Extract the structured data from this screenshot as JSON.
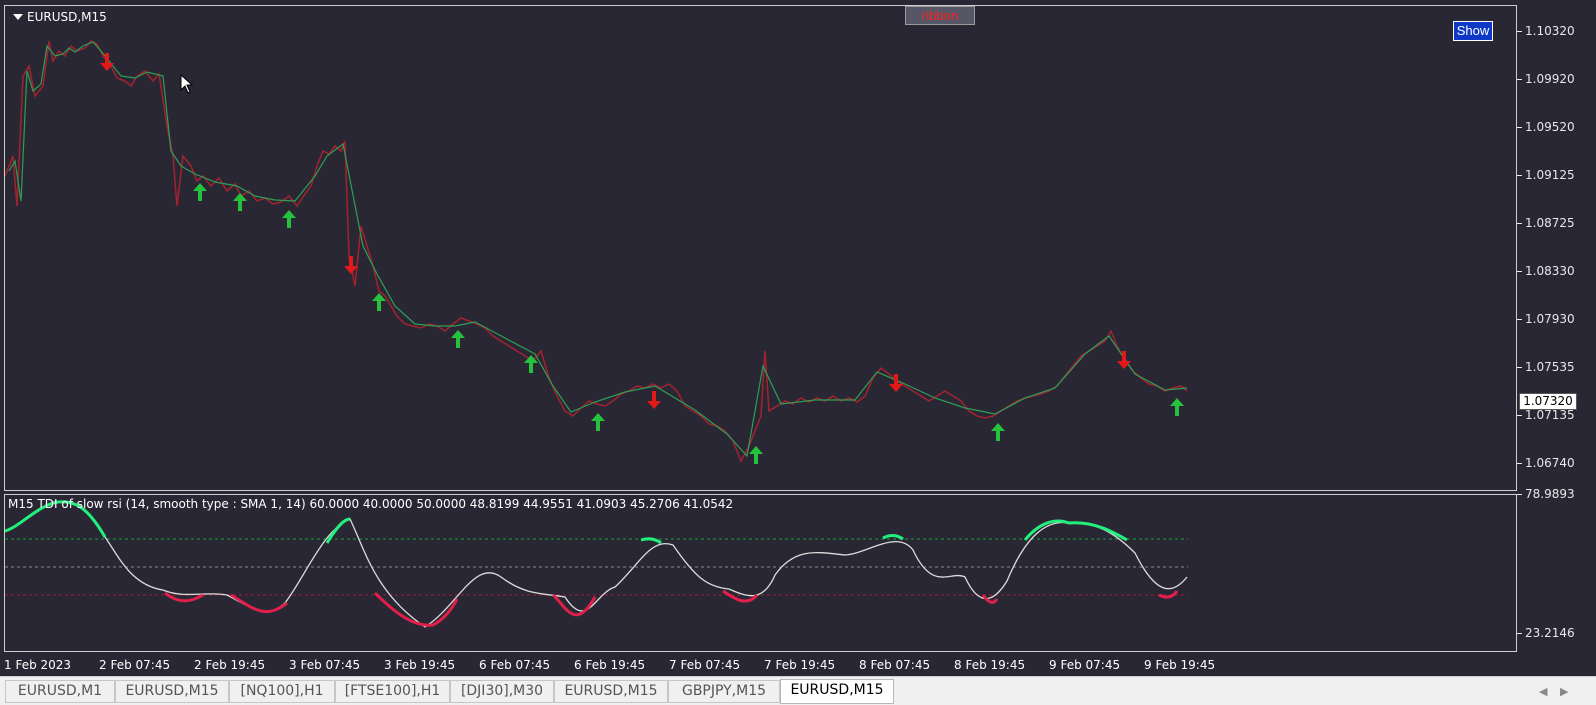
{
  "chart": {
    "symbol": "EURUSD,M15",
    "ribbon_label": "ribbon",
    "show_label": "Show",
    "price_scale": [
      "1.10320",
      "1.09920",
      "1.09520",
      "1.09125",
      "1.08725",
      "1.08330",
      "1.07930",
      "1.07535",
      "1.07135",
      "1.06740"
    ],
    "current_price": "1.07320",
    "indicator_title": "M15 TDI of slow rsi  (14, smooth type :  SMA 1, 14) 60.0000 40.0000 50.0000 48.8199 44.9551 41.0903 45.2706 41.0542",
    "indicator_scale_top": "78.9893",
    "indicator_scale_bottom": "23.2146",
    "time_labels": [
      "1 Feb 2023",
      "2 Feb 07:45",
      "2 Feb 19:45",
      "3 Feb 07:45",
      "3 Feb 19:45",
      "6 Feb 07:45",
      "6 Feb 19:45",
      "7 Feb 07:45",
      "7 Feb 19:45",
      "8 Feb 07:45",
      "8 Feb 19:45",
      "9 Feb 07:45",
      "9 Feb 19:45"
    ],
    "colors": {
      "bull": "#2e9e55",
      "bear": "#d8203d",
      "up_arrow": "#27c23c",
      "down_arrow": "#e31818",
      "tdi_high": "#22f07c",
      "tdi_low": "#e0204a",
      "tdi_mid": "#ffffff"
    }
  },
  "tabs": [
    {
      "label": "EURUSD,M1",
      "active": false
    },
    {
      "label": "EURUSD,M15",
      "active": false
    },
    {
      "label": "[NQ100],H1",
      "active": false
    },
    {
      "label": "[FTSE100],H1",
      "active": false
    },
    {
      "label": "[DJI30],M30",
      "active": false
    },
    {
      "label": "EURUSD,M15",
      "active": false
    },
    {
      "label": "GBPJPY,M15",
      "active": false
    },
    {
      "label": "EURUSD,M15",
      "active": true
    }
  ]
}
